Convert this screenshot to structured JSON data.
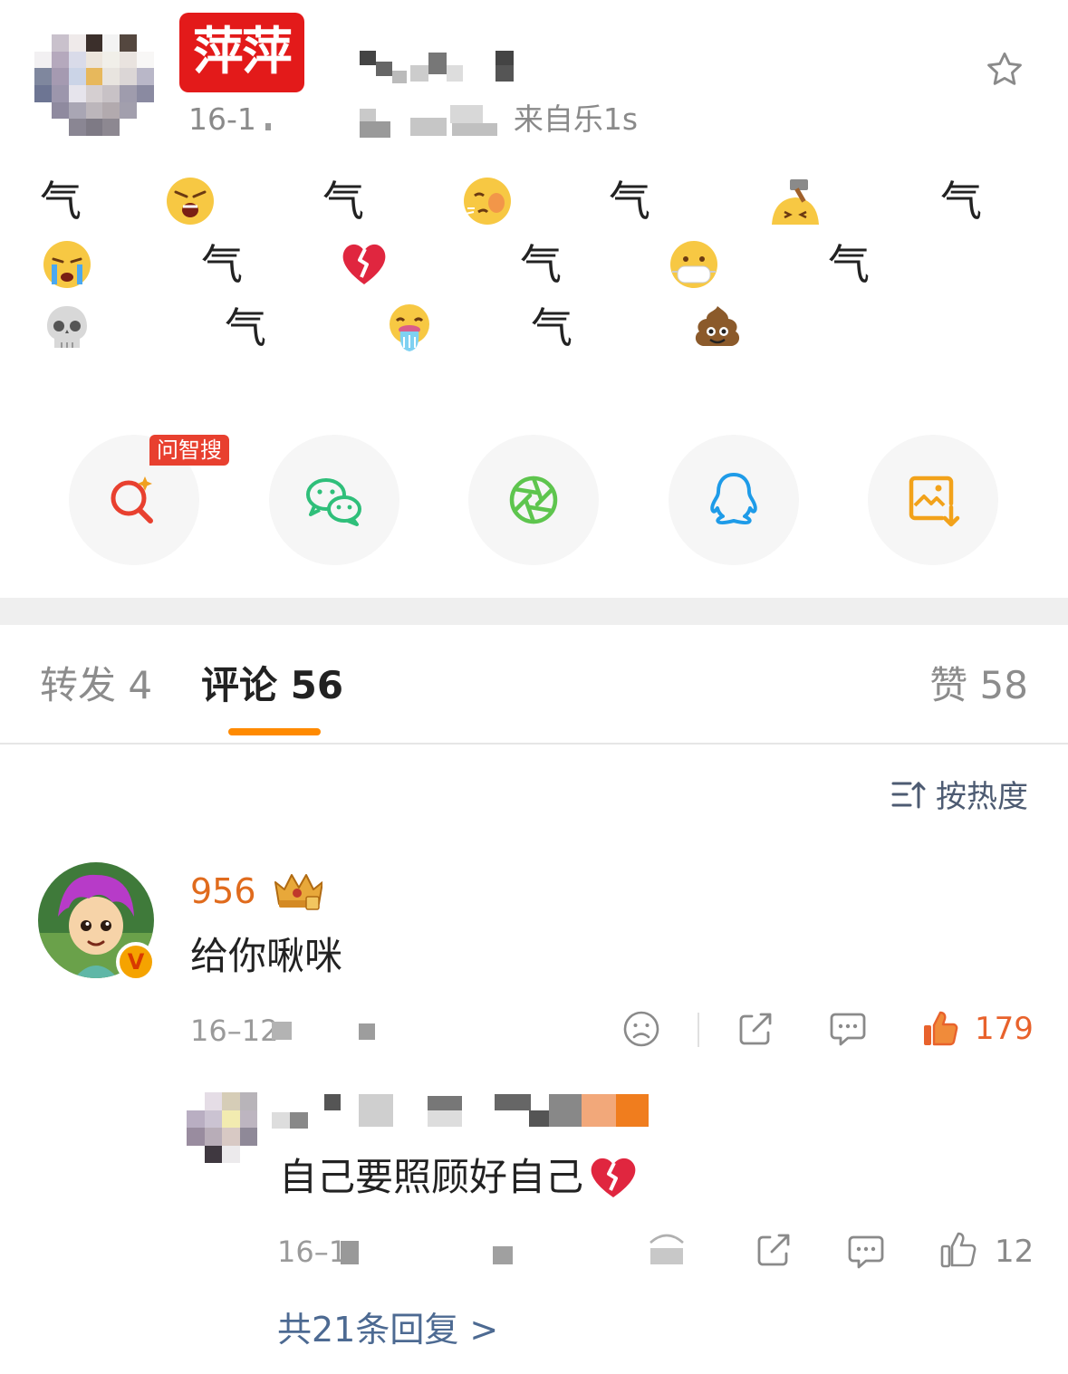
{
  "post": {
    "badge_text": "萍萍",
    "meta_date": "16-1",
    "meta_source": "来自乐1s",
    "body_rows": [
      [
        "气",
        "angry-emoji",
        "气",
        "slapped-emoji",
        "气",
        "hammered-emoji",
        "气"
      ],
      [
        "crying-emoji",
        "气",
        "broken-heart-emoji",
        "气",
        "mask-emoji",
        "气"
      ],
      [
        "skull-emoji",
        "气",
        "vomit-emoji",
        "气",
        "poop-emoji"
      ]
    ],
    "glyph": "气"
  },
  "share": {
    "ai_badge": "问智搜",
    "items": [
      "ai-search-icon",
      "wechat-icon",
      "moments-icon",
      "qq-icon",
      "save-image-icon"
    ]
  },
  "tabs": {
    "repost": "转发 4",
    "comments": "评论 56",
    "likes": "赞 58"
  },
  "sort_label": "按热度",
  "comment": {
    "name": "956",
    "text": "给你啾咪",
    "date": "16–12",
    "likes": "179",
    "v_badge": "V"
  },
  "reply": {
    "text": "自己要照顾好自己",
    "date": "16–1",
    "likes": "12",
    "more": "共21条回复 >"
  },
  "colors": {
    "badge_red": "#e31a1a",
    "username_orange": "#e06b1d",
    "tab_underline": "#ff8a00",
    "link_blue": "#4d6a92",
    "like_active": "#e8622c"
  }
}
